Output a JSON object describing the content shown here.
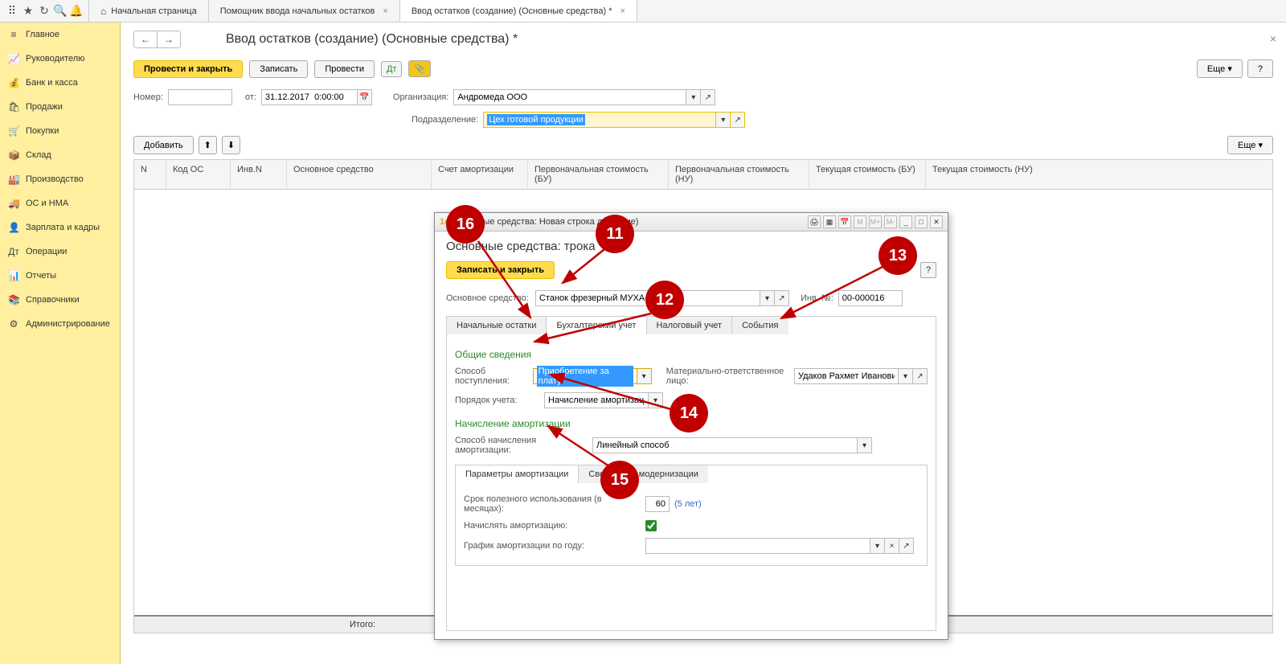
{
  "top_toolbar": {
    "tabs": [
      {
        "label": "Начальная страница",
        "has_home": true
      },
      {
        "label": "Помощник ввода начальных остатков",
        "closable": true
      },
      {
        "label": "Ввод остатков (создание) (Основные средства) *",
        "closable": true,
        "active": true
      }
    ]
  },
  "sidebar": {
    "items": [
      {
        "icon": "≡",
        "label": "Главное"
      },
      {
        "icon": "📈",
        "label": "Руководителю"
      },
      {
        "icon": "💰",
        "label": "Банк и касса"
      },
      {
        "icon": "🛍",
        "label": "Продажи"
      },
      {
        "icon": "🛒",
        "label": "Покупки"
      },
      {
        "icon": "📦",
        "label": "Склад"
      },
      {
        "icon": "🏭",
        "label": "Производство"
      },
      {
        "icon": "🚚",
        "label": "ОС и НМА"
      },
      {
        "icon": "👤",
        "label": "Зарплата и кадры"
      },
      {
        "icon": "Дт",
        "label": "Операции"
      },
      {
        "icon": "📊",
        "label": "Отчеты"
      },
      {
        "icon": "📚",
        "label": "Справочники"
      },
      {
        "icon": "⚙",
        "label": "Администрирование"
      }
    ]
  },
  "document": {
    "title": "Ввод остатков (создание) (Основные средства) *",
    "buttons": {
      "post_close": "Провести и закрыть",
      "write": "Записать",
      "post": "Провести",
      "more": "Еще",
      "help": "?"
    },
    "fields": {
      "number_label": "Номер:",
      "number_value": "",
      "from_label": "от:",
      "date_value": "31.12.2017  0:00:00",
      "org_label": "Организация:",
      "org_value": "Андромеда ООО",
      "dept_label": "Подразделение:",
      "dept_value": "Цех готовой продукции"
    },
    "table": {
      "add_btn": "Добавить",
      "headers": [
        "N",
        "Код ОС",
        "Инв.N",
        "Основное средство",
        "Счет амортизации",
        "Первоначальная стоимость (БУ)",
        "Первоначальная стоимость (НУ)",
        "Текущая стоимость (БУ)",
        "Текущая стоимость (НУ)"
      ],
      "footer": "Итого:"
    }
  },
  "dialog": {
    "window_title": "Основные средства: Новая строка             дприятие)",
    "title": "Основные средства:             трока *",
    "save_close": "Записать и закрыть",
    "help": "?",
    "os_label": "Основное средство:",
    "os_value": "Станок фрезерный МУХА-66",
    "invn_label": "Инв. №:",
    "invn_value": "00-000016",
    "tabs": [
      "Начальные остатки",
      "Бухгалтерский учет",
      "Налоговый учет",
      "События"
    ],
    "active_tab": "Бухгалтерский учет",
    "section1": "Общие сведения",
    "way_label": "Способ поступления:",
    "way_value": "Приобретение за плату",
    "mol_label": "Материально-ответственное лицо:",
    "mol_value": "Удаков Рахмет Иванович",
    "order_label": "Порядок учета:",
    "order_value": "Начисление амортизации",
    "section2": "Начисление амортизации",
    "amort_way_label": "Способ начисления амортизации:",
    "amort_way_value": "Линейный способ",
    "subtabs": [
      "Параметры амортизации",
      "Сведения о модернизации"
    ],
    "life_label": "Срок полезного использования (в месяцах):",
    "life_value": "60",
    "life_hint": "(5 лет)",
    "do_amort_label": "Начислять амортизацию:",
    "schedule_label": "График амортизации по году:",
    "schedule_value": ""
  },
  "callouts": {
    "c11": "11",
    "c12": "12",
    "c13": "13",
    "c14": "14",
    "c15": "15",
    "c16": "16"
  }
}
